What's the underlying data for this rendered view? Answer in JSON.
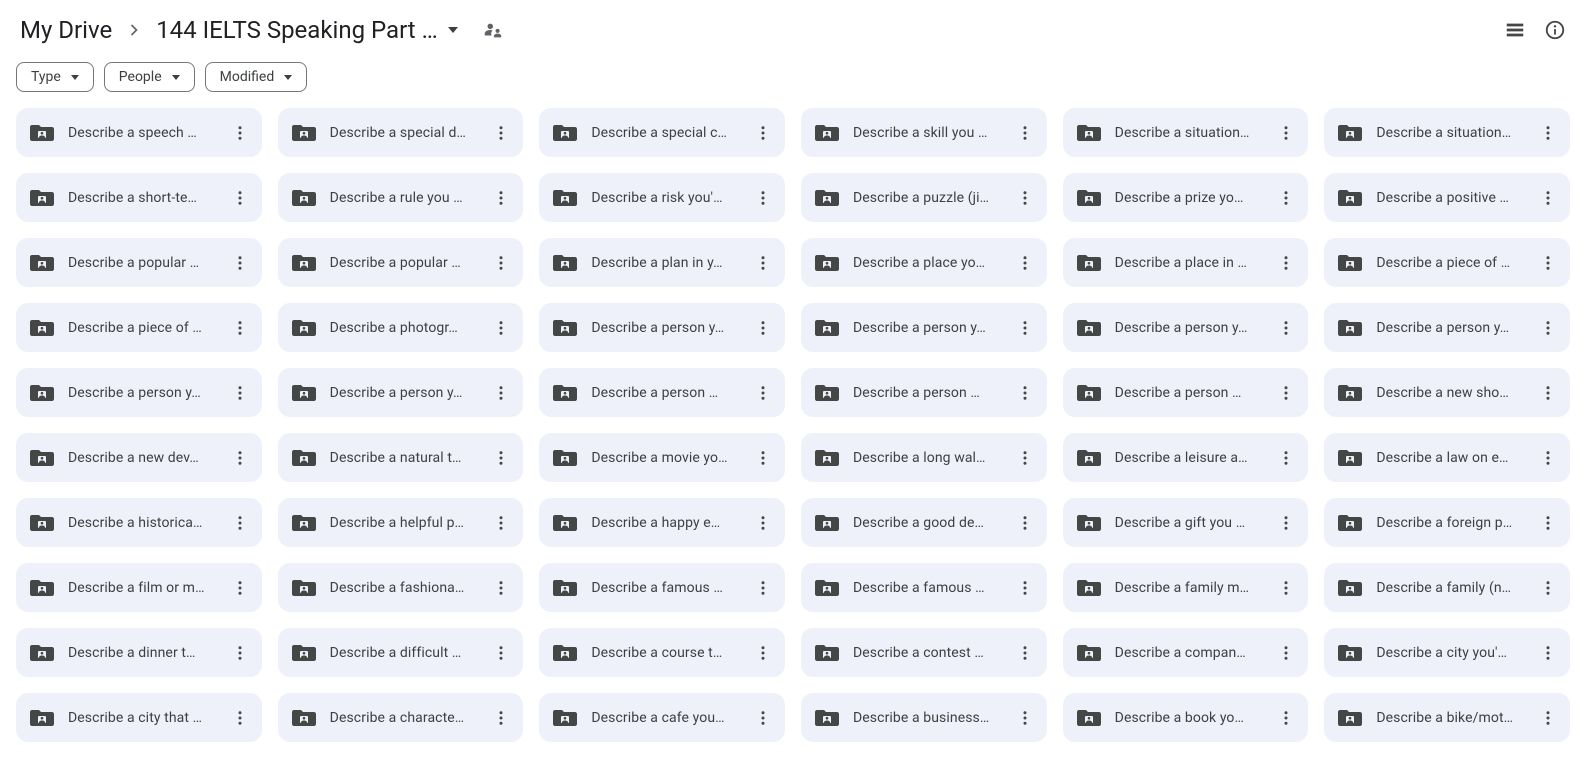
{
  "breadcrumb": {
    "root": "My Drive",
    "current": "144 IELTS Speaking Part …"
  },
  "filters": [
    {
      "label": "Type"
    },
    {
      "label": "People"
    },
    {
      "label": "Modified"
    }
  ],
  "folders": [
    "Describe a speech …",
    "Describe a special d…",
    "Describe a special c…",
    "Describe a skill you …",
    "Describe a situation…",
    "Describe a situation…",
    "Describe a short-te…",
    "Describe a rule you …",
    "Describe a risk you'…",
    "Describe a puzzle (ji…",
    "Describe a prize yo…",
    "Describe a positive …",
    "Describe a popular …",
    "Describe a popular …",
    "Describe a plan in y…",
    "Describe a place yo…",
    "Describe a place in …",
    "Describe a piece of …",
    "Describe a piece of …",
    "Describe a photogr…",
    "Describe a person y…",
    "Describe a person y…",
    "Describe a person y…",
    "Describe a person y…",
    "Describe a person y…",
    "Describe a person y…",
    "Describe a person …",
    "Describe a person …",
    "Describe a person …",
    "Describe a new sho…",
    "Describe a new dev…",
    "Describe a natural t…",
    "Describe a movie yo…",
    "Describe a long wal…",
    "Describe a leisure a…",
    "Describe a law on e…",
    "Describe a historica…",
    "Describe a helpful p…",
    "Describe a happy e…",
    "Describe a good de…",
    "Describe a gift you …",
    "Describe a foreign p…",
    "Describe a film or m…",
    "Describe a fashiona…",
    "Describe a famous …",
    "Describe a famous …",
    "Describe a family m…",
    "Describe a family (n…",
    "Describe a dinner t…",
    "Describe a difficult …",
    "Describe a course t…",
    "Describe a contest …",
    "Describe a compan…",
    "Describe a city you'…",
    "Describe a city that …",
    "Describe a characte…",
    "Describe a cafe you…",
    "Describe a business…",
    "Describe a book yo…",
    "Describe a bike/mot…"
  ]
}
